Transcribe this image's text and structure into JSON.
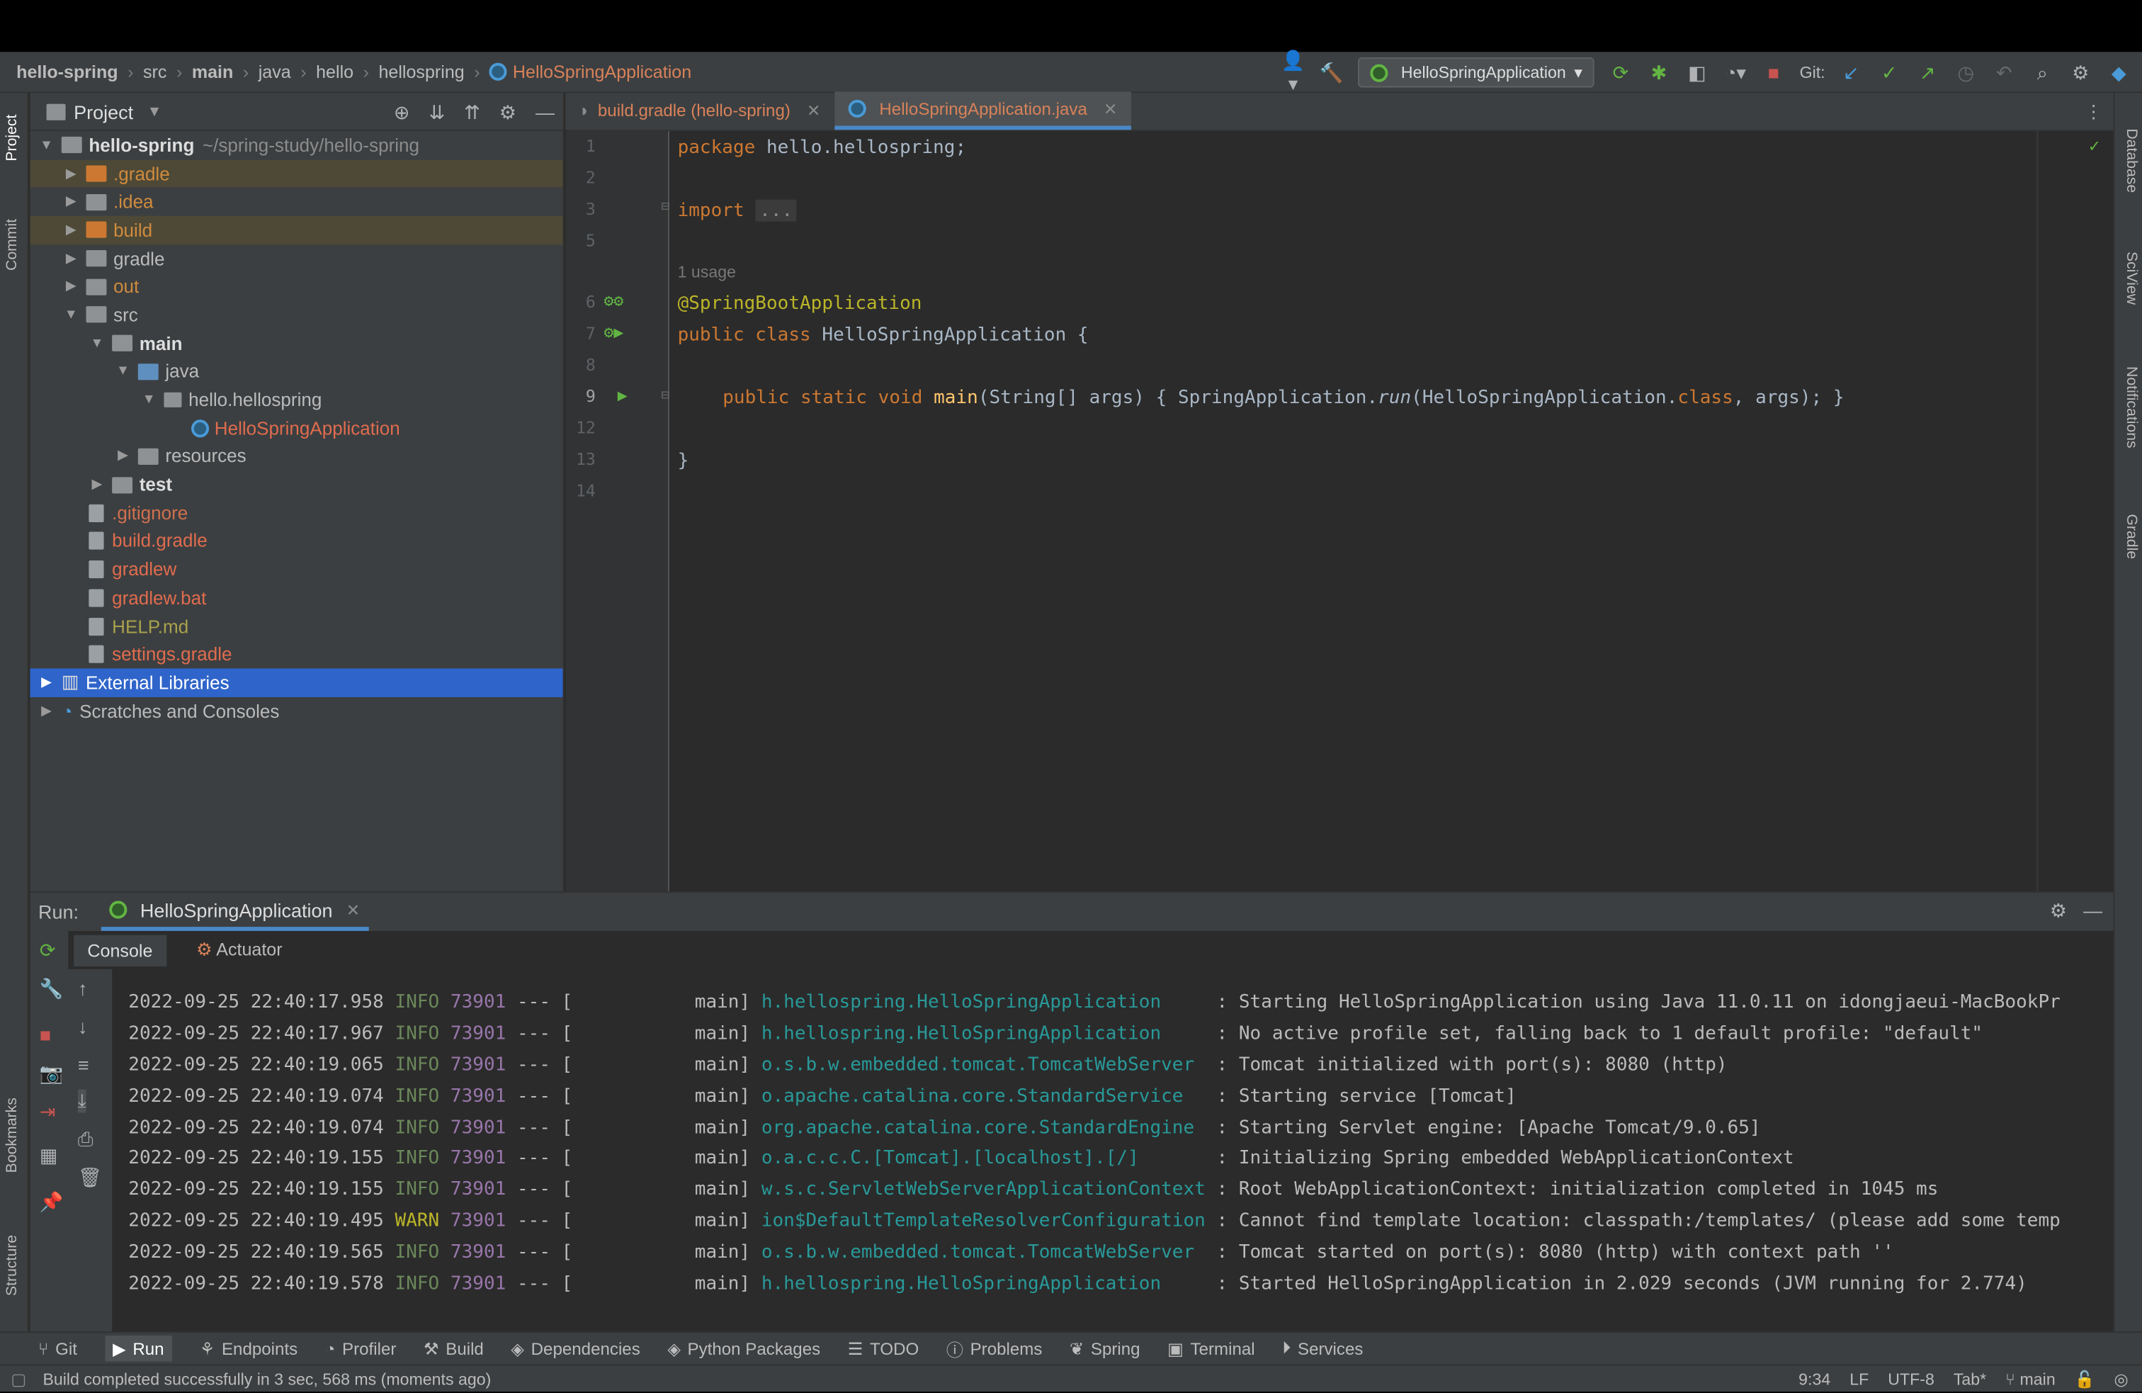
{
  "breadcrumbs": [
    "hello-spring",
    "src",
    "main",
    "java",
    "hello",
    "hellospring",
    "HelloSpringApplication"
  ],
  "toolbar": {
    "run_config": "HelloSpringApplication",
    "git_label": "Git:"
  },
  "left_strip": {
    "project": "Project",
    "commit": "Commit",
    "bookmarks": "Bookmarks",
    "structure": "Structure"
  },
  "right_strip": {
    "database": "Database",
    "sciview": "SciView",
    "notifications": "Notifications",
    "gradle": "Gradle"
  },
  "project_panel": {
    "title": "Project",
    "tree": [
      {
        "label": "hello-spring",
        "extra": "~/spring-study/hello-spring"
      },
      {
        "label": ".gradle"
      },
      {
        "label": ".idea"
      },
      {
        "label": "build"
      },
      {
        "label": "gradle"
      },
      {
        "label": "out"
      },
      {
        "label": "src"
      },
      {
        "label": "main"
      },
      {
        "label": "java"
      },
      {
        "label": "hello.hellospring"
      },
      {
        "label": "HelloSpringApplication"
      },
      {
        "label": "resources"
      },
      {
        "label": "test"
      },
      {
        "label": ".gitignore"
      },
      {
        "label": "build.gradle"
      },
      {
        "label": "gradlew"
      },
      {
        "label": "gradlew.bat"
      },
      {
        "label": "HELP.md"
      },
      {
        "label": "settings.gradle"
      },
      {
        "label": "External Libraries"
      },
      {
        "label": "Scratches and Consoles"
      }
    ]
  },
  "editor": {
    "tabs": [
      {
        "label": "build.gradle (hello-spring)"
      },
      {
        "label": "HelloSpringApplication.java"
      }
    ],
    "line_numbers": [
      "1",
      "2",
      "3",
      "5",
      "6",
      "7",
      "8",
      "9",
      "12",
      "13",
      "14"
    ],
    "code": {
      "l1_kw": "package",
      "l1_rest": " hello.hellospring;",
      "l3_kw": "import",
      "l3_fold": "...",
      "usage_hint": "1 usage",
      "l6": "@SpringBootApplication",
      "l7_kw": "public class",
      "l7_rest": " HelloSpringApplication {",
      "l9_kw": "public static void",
      "l9_fn": "main",
      "l9_args": "(String[] args) { SpringApplication.",
      "l9_run": "run",
      "l9_mid": "(HelloSpringApplication.",
      "l9_class": "class",
      "l9_end": ", args); }",
      "l13": "}"
    }
  },
  "run_panel": {
    "label": "Run:",
    "tab": "HelloSpringApplication",
    "subtabs": [
      "Console",
      "Actuator"
    ],
    "logs": [
      {
        "ts": "2022-09-25 22:40:17.958",
        "lvl": "INFO",
        "pid": "73901",
        "sep": " --- [           main] ",
        "logger": "h.hellospring.HelloSpringApplication    ",
        "msg": " : Starting HelloSpringApplication using Java 11.0.11 on idongjaeui-MacBookPr"
      },
      {
        "ts": "2022-09-25 22:40:17.967",
        "lvl": "INFO",
        "pid": "73901",
        "sep": " --- [           main] ",
        "logger": "h.hellospring.HelloSpringApplication    ",
        "msg": " : No active profile set, falling back to 1 default profile: \"default\""
      },
      {
        "ts": "2022-09-25 22:40:19.065",
        "lvl": "INFO",
        "pid": "73901",
        "sep": " --- [           main] ",
        "logger": "o.s.b.w.embedded.tomcat.TomcatWebServer ",
        "msg": " : Tomcat initialized with port(s): 8080 (http)"
      },
      {
        "ts": "2022-09-25 22:40:19.074",
        "lvl": "INFO",
        "pid": "73901",
        "sep": " --- [           main] ",
        "logger": "o.apache.catalina.core.StandardService  ",
        "msg": " : Starting service [Tomcat]"
      },
      {
        "ts": "2022-09-25 22:40:19.074",
        "lvl": "INFO",
        "pid": "73901",
        "sep": " --- [           main] ",
        "logger": "org.apache.catalina.core.StandardEngine ",
        "msg": " : Starting Servlet engine: [Apache Tomcat/9.0.65]"
      },
      {
        "ts": "2022-09-25 22:40:19.155",
        "lvl": "INFO",
        "pid": "73901",
        "sep": " --- [           main] ",
        "logger": "o.a.c.c.C.[Tomcat].[localhost].[/]      ",
        "msg": " : Initializing Spring embedded WebApplicationContext"
      },
      {
        "ts": "2022-09-25 22:40:19.155",
        "lvl": "INFO",
        "pid": "73901",
        "sep": " --- [           main] ",
        "logger": "w.s.c.ServletWebServerApplicationContext",
        "msg": " : Root WebApplicationContext: initialization completed in 1045 ms"
      },
      {
        "ts": "2022-09-25 22:40:19.495",
        "lvl": "WARN",
        "pid": "73901",
        "sep": " --- [           main] ",
        "logger": "ion$DefaultTemplateResolverConfiguration",
        "msg": " : Cannot find template location: classpath:/templates/ (please add some temp"
      },
      {
        "ts": "2022-09-25 22:40:19.565",
        "lvl": "INFO",
        "pid": "73901",
        "sep": " --- [           main] ",
        "logger": "o.s.b.w.embedded.tomcat.TomcatWebServer ",
        "msg": " : Tomcat started on port(s): 8080 (http) with context path ''"
      },
      {
        "ts": "2022-09-25 22:40:19.578",
        "lvl": "INFO",
        "pid": "73901",
        "sep": " --- [           main] ",
        "logger": "h.hellospring.HelloSpringApplication    ",
        "msg": " : Started HelloSpringApplication in 2.029 seconds (JVM running for 2.774)"
      }
    ]
  },
  "tool_windows": [
    "Git",
    "Run",
    "Endpoints",
    "Profiler",
    "Build",
    "Dependencies",
    "Python Packages",
    "TODO",
    "Problems",
    "Spring",
    "Terminal",
    "Services"
  ],
  "status": {
    "message": "Build completed successfully in 3 sec, 568 ms (moments ago)",
    "position": "9:34",
    "line_sep": "LF",
    "encoding": "UTF-8",
    "indent": "Tab*",
    "branch": "main"
  },
  "colors": {
    "accent": "#2f65ca",
    "tab_underline": "#4a88c7",
    "keyword": "#cc7832",
    "annotation": "#bbb529"
  }
}
